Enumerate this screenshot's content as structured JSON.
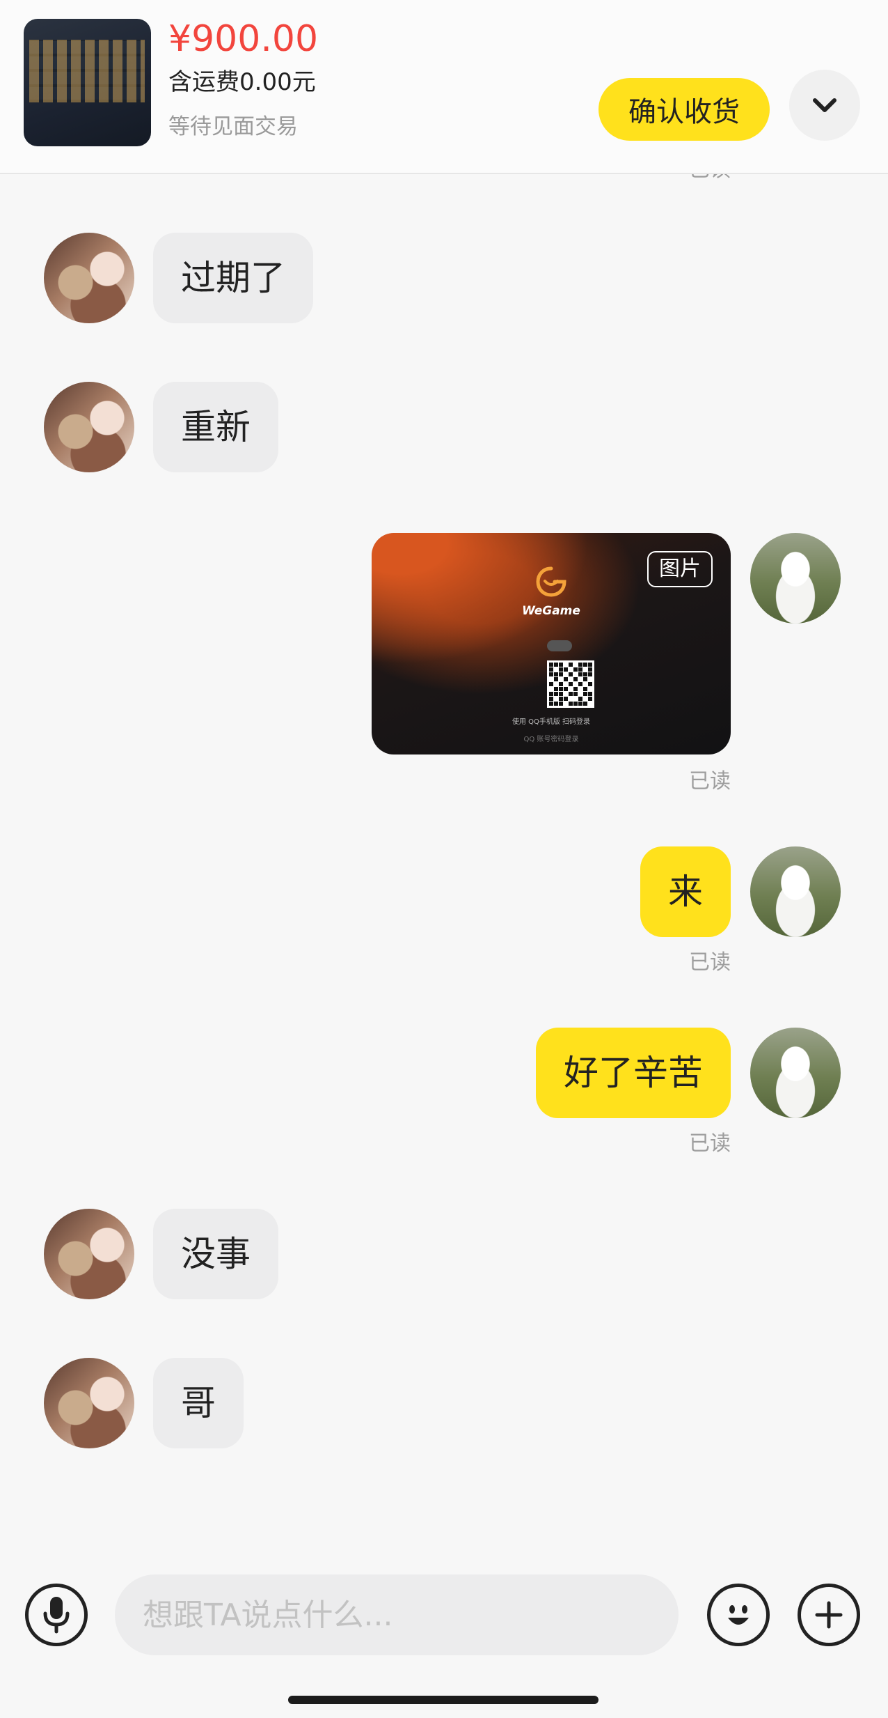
{
  "header": {
    "price": "¥900.00",
    "shipping": "含运费0.00元",
    "status": "等待见面交易",
    "confirm_label": "确认收货"
  },
  "messages": {
    "m1": "过期了",
    "m2": "重新",
    "image_tag": "图片",
    "wegame_name": "WeGame",
    "qr_hint": "使用 QQ手机版 扫码登录",
    "qr_hint2": "QQ 账号密码登录",
    "m3": "来",
    "m4": "好了辛苦",
    "m5": "没事",
    "m6": "哥",
    "read_label": "已读"
  },
  "input": {
    "placeholder": "想跟TA说点什么..."
  },
  "colors": {
    "accent_yellow": "#ffe11c",
    "price_red": "#f2453d",
    "incoming_bubble": "#ececed"
  },
  "icons": [
    "chevron-down-icon",
    "microphone-icon",
    "emoji-icon",
    "plus-icon",
    "wegame-logo-icon"
  ]
}
